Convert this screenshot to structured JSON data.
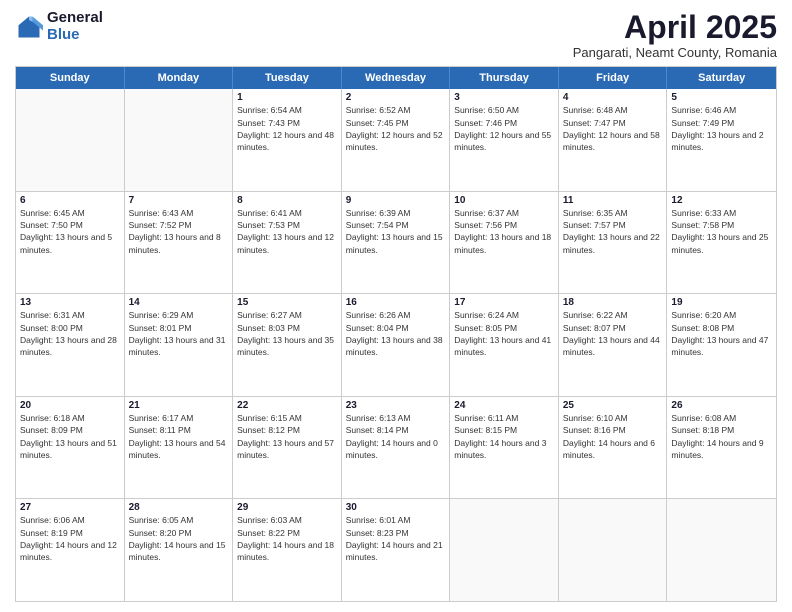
{
  "logo": {
    "general": "General",
    "blue": "Blue"
  },
  "header": {
    "title": "April 2025",
    "subtitle": "Pangarati, Neamt County, Romania"
  },
  "days": [
    "Sunday",
    "Monday",
    "Tuesday",
    "Wednesday",
    "Thursday",
    "Friday",
    "Saturday"
  ],
  "weeks": [
    [
      {
        "day": "",
        "sunrise": "",
        "sunset": "",
        "daylight": "",
        "empty": true
      },
      {
        "day": "",
        "sunrise": "",
        "sunset": "",
        "daylight": "",
        "empty": true
      },
      {
        "day": "1",
        "sunrise": "Sunrise: 6:54 AM",
        "sunset": "Sunset: 7:43 PM",
        "daylight": "Daylight: 12 hours and 48 minutes.",
        "empty": false
      },
      {
        "day": "2",
        "sunrise": "Sunrise: 6:52 AM",
        "sunset": "Sunset: 7:45 PM",
        "daylight": "Daylight: 12 hours and 52 minutes.",
        "empty": false
      },
      {
        "day": "3",
        "sunrise": "Sunrise: 6:50 AM",
        "sunset": "Sunset: 7:46 PM",
        "daylight": "Daylight: 12 hours and 55 minutes.",
        "empty": false
      },
      {
        "day": "4",
        "sunrise": "Sunrise: 6:48 AM",
        "sunset": "Sunset: 7:47 PM",
        "daylight": "Daylight: 12 hours and 58 minutes.",
        "empty": false
      },
      {
        "day": "5",
        "sunrise": "Sunrise: 6:46 AM",
        "sunset": "Sunset: 7:49 PM",
        "daylight": "Daylight: 13 hours and 2 minutes.",
        "empty": false
      }
    ],
    [
      {
        "day": "6",
        "sunrise": "Sunrise: 6:45 AM",
        "sunset": "Sunset: 7:50 PM",
        "daylight": "Daylight: 13 hours and 5 minutes.",
        "empty": false
      },
      {
        "day": "7",
        "sunrise": "Sunrise: 6:43 AM",
        "sunset": "Sunset: 7:52 PM",
        "daylight": "Daylight: 13 hours and 8 minutes.",
        "empty": false
      },
      {
        "day": "8",
        "sunrise": "Sunrise: 6:41 AM",
        "sunset": "Sunset: 7:53 PM",
        "daylight": "Daylight: 13 hours and 12 minutes.",
        "empty": false
      },
      {
        "day": "9",
        "sunrise": "Sunrise: 6:39 AM",
        "sunset": "Sunset: 7:54 PM",
        "daylight": "Daylight: 13 hours and 15 minutes.",
        "empty": false
      },
      {
        "day": "10",
        "sunrise": "Sunrise: 6:37 AM",
        "sunset": "Sunset: 7:56 PM",
        "daylight": "Daylight: 13 hours and 18 minutes.",
        "empty": false
      },
      {
        "day": "11",
        "sunrise": "Sunrise: 6:35 AM",
        "sunset": "Sunset: 7:57 PM",
        "daylight": "Daylight: 13 hours and 22 minutes.",
        "empty": false
      },
      {
        "day": "12",
        "sunrise": "Sunrise: 6:33 AM",
        "sunset": "Sunset: 7:58 PM",
        "daylight": "Daylight: 13 hours and 25 minutes.",
        "empty": false
      }
    ],
    [
      {
        "day": "13",
        "sunrise": "Sunrise: 6:31 AM",
        "sunset": "Sunset: 8:00 PM",
        "daylight": "Daylight: 13 hours and 28 minutes.",
        "empty": false
      },
      {
        "day": "14",
        "sunrise": "Sunrise: 6:29 AM",
        "sunset": "Sunset: 8:01 PM",
        "daylight": "Daylight: 13 hours and 31 minutes.",
        "empty": false
      },
      {
        "day": "15",
        "sunrise": "Sunrise: 6:27 AM",
        "sunset": "Sunset: 8:03 PM",
        "daylight": "Daylight: 13 hours and 35 minutes.",
        "empty": false
      },
      {
        "day": "16",
        "sunrise": "Sunrise: 6:26 AM",
        "sunset": "Sunset: 8:04 PM",
        "daylight": "Daylight: 13 hours and 38 minutes.",
        "empty": false
      },
      {
        "day": "17",
        "sunrise": "Sunrise: 6:24 AM",
        "sunset": "Sunset: 8:05 PM",
        "daylight": "Daylight: 13 hours and 41 minutes.",
        "empty": false
      },
      {
        "day": "18",
        "sunrise": "Sunrise: 6:22 AM",
        "sunset": "Sunset: 8:07 PM",
        "daylight": "Daylight: 13 hours and 44 minutes.",
        "empty": false
      },
      {
        "day": "19",
        "sunrise": "Sunrise: 6:20 AM",
        "sunset": "Sunset: 8:08 PM",
        "daylight": "Daylight: 13 hours and 47 minutes.",
        "empty": false
      }
    ],
    [
      {
        "day": "20",
        "sunrise": "Sunrise: 6:18 AM",
        "sunset": "Sunset: 8:09 PM",
        "daylight": "Daylight: 13 hours and 51 minutes.",
        "empty": false
      },
      {
        "day": "21",
        "sunrise": "Sunrise: 6:17 AM",
        "sunset": "Sunset: 8:11 PM",
        "daylight": "Daylight: 13 hours and 54 minutes.",
        "empty": false
      },
      {
        "day": "22",
        "sunrise": "Sunrise: 6:15 AM",
        "sunset": "Sunset: 8:12 PM",
        "daylight": "Daylight: 13 hours and 57 minutes.",
        "empty": false
      },
      {
        "day": "23",
        "sunrise": "Sunrise: 6:13 AM",
        "sunset": "Sunset: 8:14 PM",
        "daylight": "Daylight: 14 hours and 0 minutes.",
        "empty": false
      },
      {
        "day": "24",
        "sunrise": "Sunrise: 6:11 AM",
        "sunset": "Sunset: 8:15 PM",
        "daylight": "Daylight: 14 hours and 3 minutes.",
        "empty": false
      },
      {
        "day": "25",
        "sunrise": "Sunrise: 6:10 AM",
        "sunset": "Sunset: 8:16 PM",
        "daylight": "Daylight: 14 hours and 6 minutes.",
        "empty": false
      },
      {
        "day": "26",
        "sunrise": "Sunrise: 6:08 AM",
        "sunset": "Sunset: 8:18 PM",
        "daylight": "Daylight: 14 hours and 9 minutes.",
        "empty": false
      }
    ],
    [
      {
        "day": "27",
        "sunrise": "Sunrise: 6:06 AM",
        "sunset": "Sunset: 8:19 PM",
        "daylight": "Daylight: 14 hours and 12 minutes.",
        "empty": false
      },
      {
        "day": "28",
        "sunrise": "Sunrise: 6:05 AM",
        "sunset": "Sunset: 8:20 PM",
        "daylight": "Daylight: 14 hours and 15 minutes.",
        "empty": false
      },
      {
        "day": "29",
        "sunrise": "Sunrise: 6:03 AM",
        "sunset": "Sunset: 8:22 PM",
        "daylight": "Daylight: 14 hours and 18 minutes.",
        "empty": false
      },
      {
        "day": "30",
        "sunrise": "Sunrise: 6:01 AM",
        "sunset": "Sunset: 8:23 PM",
        "daylight": "Daylight: 14 hours and 21 minutes.",
        "empty": false
      },
      {
        "day": "",
        "sunrise": "",
        "sunset": "",
        "daylight": "",
        "empty": true
      },
      {
        "day": "",
        "sunrise": "",
        "sunset": "",
        "daylight": "",
        "empty": true
      },
      {
        "day": "",
        "sunrise": "",
        "sunset": "",
        "daylight": "",
        "empty": true
      }
    ]
  ]
}
